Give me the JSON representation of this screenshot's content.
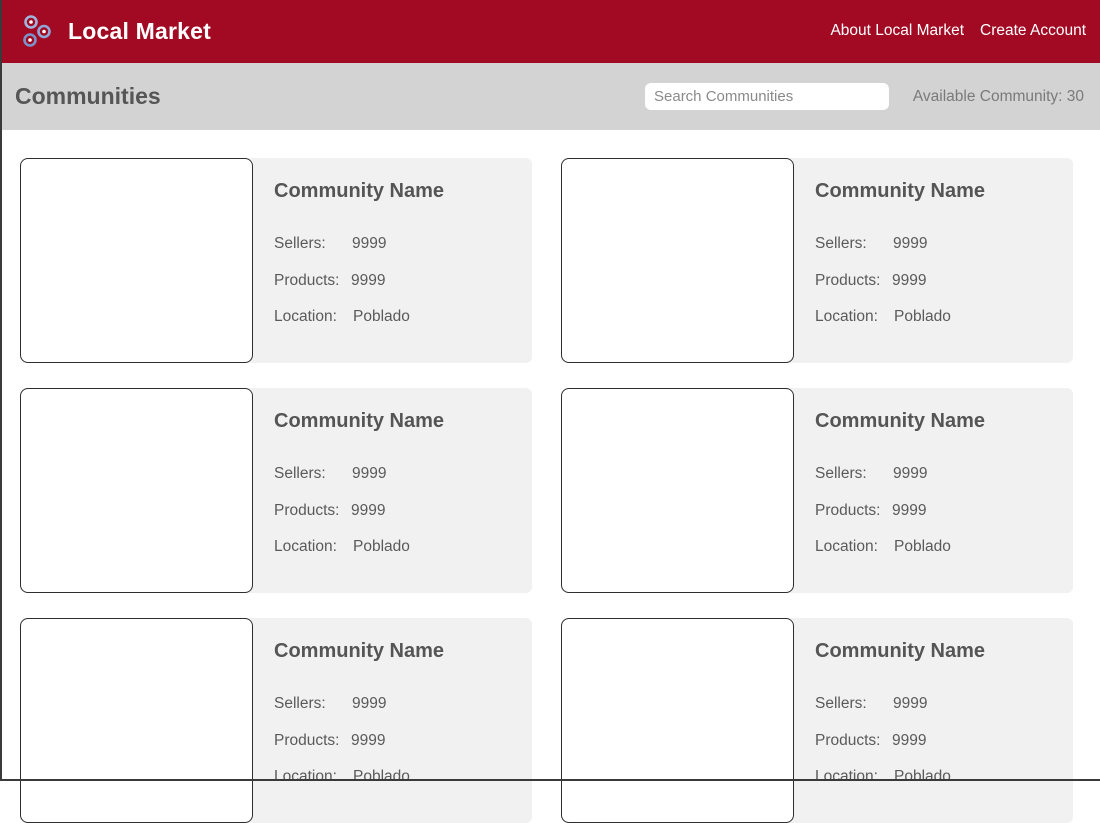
{
  "header": {
    "brand": "Local Market",
    "nav": {
      "about": "About Local Market",
      "create_account": "Create Account"
    },
    "brand_color": "#a20a23",
    "logo_icon": "interlinked-circles-logo-icon"
  },
  "subheader": {
    "title": "Communities",
    "search_placeholder": "Search Communities",
    "available": "Available Community: 30"
  },
  "labels": {
    "sellers": "Sellers:",
    "products": "Products:",
    "location": "Location:"
  },
  "communities": [
    {
      "name": "Community Name",
      "sellers": "9999",
      "products": "9999",
      "location": "Poblado"
    },
    {
      "name": "Community Name",
      "sellers": "9999",
      "products": "9999",
      "location": "Poblado"
    },
    {
      "name": "Community Name",
      "sellers": "9999",
      "products": "9999",
      "location": "Poblado"
    },
    {
      "name": "Community Name",
      "sellers": "9999",
      "products": "9999",
      "location": "Poblado"
    },
    {
      "name": "Community Name",
      "sellers": "9999",
      "products": "9999",
      "location": "Poblado"
    },
    {
      "name": "Community Name",
      "sellers": "9999",
      "products": "9999",
      "location": "Poblado"
    }
  ]
}
